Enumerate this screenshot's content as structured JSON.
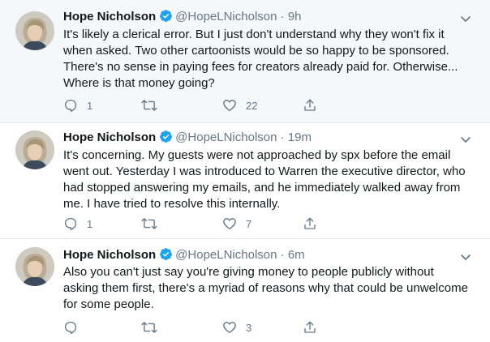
{
  "tweets": [
    {
      "author": {
        "name": "Hope Nicholson",
        "handle": "@HopeLNicholson"
      },
      "separator": "·",
      "time": "9h",
      "text_lines": [
        "It's likely a clerical error. But I just don't understand why they won't fix it",
        "when asked. Two other cartoonists would be so happy to be sponsored.",
        "There's no sense in paying fees for creators already paid for. Otherwise...",
        "Where is that money going?"
      ],
      "reply_count": "1",
      "retweet_count": "",
      "like_count": "22"
    },
    {
      "author": {
        "name": "Hope Nicholson",
        "handle": "@HopeLNicholson"
      },
      "separator": "·",
      "time": "19m",
      "text_lines": [
        "It's concerning. My guests were not approached by spx before the email",
        "went out. Yesterday I was introduced to Warren the executive director, who",
        "had stopped answering my emails, and he immediately walked away from",
        "me. I have tried to resolve this internally."
      ],
      "reply_count": "1",
      "retweet_count": "",
      "like_count": "7"
    },
    {
      "author": {
        "name": "Hope Nicholson",
        "handle": "@HopeLNicholson"
      },
      "separator": "·",
      "time": "6m",
      "text_lines": [
        "Also you can't just say you're giving money to people publicly without",
        "asking them first, there's a myriad of reasons why that could be unwelcome",
        "for some people."
      ],
      "reply_count": "",
      "retweet_count": "",
      "like_count": "3"
    }
  ],
  "icons": {
    "verified": "verified-badge-icon",
    "caret": "chevron-down-icon",
    "reply": "reply-icon",
    "retweet": "retweet-icon",
    "like": "heart-icon",
    "share": "share-icon"
  },
  "colors": {
    "verified": "#1da1f2",
    "muted": "#657786",
    "text": "#14171a",
    "highlight_bg": "#f5f8fa",
    "divider": "#e6ecf0"
  }
}
